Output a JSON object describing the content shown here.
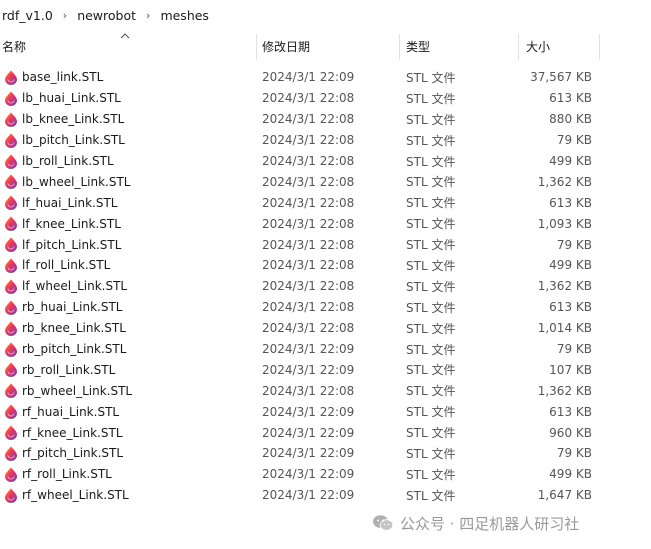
{
  "breadcrumb": [
    "rdf_v1.0",
    "newrobot",
    "meshes"
  ],
  "columns": {
    "name": "名称",
    "date": "修改日期",
    "type": "类型",
    "size": "大小"
  },
  "files": [
    {
      "name": "base_link.STL",
      "date": "2024/3/1 22:09",
      "type": "STL 文件",
      "size": "37,567 KB"
    },
    {
      "name": "lb_huai_Link.STL",
      "date": "2024/3/1 22:08",
      "type": "STL 文件",
      "size": "613 KB"
    },
    {
      "name": "lb_knee_Link.STL",
      "date": "2024/3/1 22:08",
      "type": "STL 文件",
      "size": "880 KB"
    },
    {
      "name": "lb_pitch_Link.STL",
      "date": "2024/3/1 22:08",
      "type": "STL 文件",
      "size": "79 KB"
    },
    {
      "name": "lb_roll_Link.STL",
      "date": "2024/3/1 22:08",
      "type": "STL 文件",
      "size": "499 KB"
    },
    {
      "name": "lb_wheel_Link.STL",
      "date": "2024/3/1 22:08",
      "type": "STL 文件",
      "size": "1,362 KB"
    },
    {
      "name": "lf_huai_Link.STL",
      "date": "2024/3/1 22:08",
      "type": "STL 文件",
      "size": "613 KB"
    },
    {
      "name": "lf_knee_Link.STL",
      "date": "2024/3/1 22:08",
      "type": "STL 文件",
      "size": "1,093 KB"
    },
    {
      "name": "lf_pitch_Link.STL",
      "date": "2024/3/1 22:08",
      "type": "STL 文件",
      "size": "79 KB"
    },
    {
      "name": "lf_roll_Link.STL",
      "date": "2024/3/1 22:08",
      "type": "STL 文件",
      "size": "499 KB"
    },
    {
      "name": "lf_wheel_Link.STL",
      "date": "2024/3/1 22:08",
      "type": "STL 文件",
      "size": "1,362 KB"
    },
    {
      "name": "rb_huai_Link.STL",
      "date": "2024/3/1 22:08",
      "type": "STL 文件",
      "size": "613 KB"
    },
    {
      "name": "rb_knee_Link.STL",
      "date": "2024/3/1 22:08",
      "type": "STL 文件",
      "size": "1,014 KB"
    },
    {
      "name": "rb_pitch_Link.STL",
      "date": "2024/3/1 22:09",
      "type": "STL 文件",
      "size": "79 KB"
    },
    {
      "name": "rb_roll_Link.STL",
      "date": "2024/3/1 22:09",
      "type": "STL 文件",
      "size": "107 KB"
    },
    {
      "name": "rb_wheel_Link.STL",
      "date": "2024/3/1 22:08",
      "type": "STL 文件",
      "size": "1,362 KB"
    },
    {
      "name": "rf_huai_Link.STL",
      "date": "2024/3/1 22:09",
      "type": "STL 文件",
      "size": "613 KB"
    },
    {
      "name": "rf_knee_Link.STL",
      "date": "2024/3/1 22:09",
      "type": "STL 文件",
      "size": "960 KB"
    },
    {
      "name": "rf_pitch_Link.STL",
      "date": "2024/3/1 22:09",
      "type": "STL 文件",
      "size": "79 KB"
    },
    {
      "name": "rf_roll_Link.STL",
      "date": "2024/3/1 22:09",
      "type": "STL 文件",
      "size": "499 KB"
    },
    {
      "name": "rf_wheel_Link.STL",
      "date": "2024/3/1 22:09",
      "type": "STL 文件",
      "size": "1,647 KB"
    }
  ],
  "file_icon": "stl-file-icon",
  "watermark": "公众号 · 四足机器人研习社"
}
